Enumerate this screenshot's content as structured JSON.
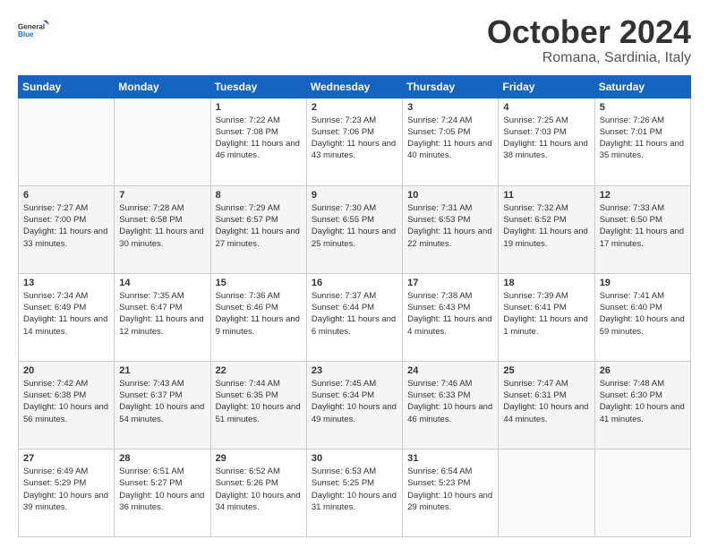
{
  "header": {
    "logo_general": "General",
    "logo_blue": "Blue",
    "month": "October 2024",
    "location": "Romana, Sardinia, Italy"
  },
  "weekdays": [
    "Sunday",
    "Monday",
    "Tuesday",
    "Wednesday",
    "Thursday",
    "Friday",
    "Saturday"
  ],
  "weeks": [
    [
      {
        "day": "",
        "sunrise": "",
        "sunset": "",
        "daylight": ""
      },
      {
        "day": "",
        "sunrise": "",
        "sunset": "",
        "daylight": ""
      },
      {
        "day": "1",
        "sunrise": "Sunrise: 7:22 AM",
        "sunset": "Sunset: 7:08 PM",
        "daylight": "Daylight: 11 hours and 46 minutes."
      },
      {
        "day": "2",
        "sunrise": "Sunrise: 7:23 AM",
        "sunset": "Sunset: 7:06 PM",
        "daylight": "Daylight: 11 hours and 43 minutes."
      },
      {
        "day": "3",
        "sunrise": "Sunrise: 7:24 AM",
        "sunset": "Sunset: 7:05 PM",
        "daylight": "Daylight: 11 hours and 40 minutes."
      },
      {
        "day": "4",
        "sunrise": "Sunrise: 7:25 AM",
        "sunset": "Sunset: 7:03 PM",
        "daylight": "Daylight: 11 hours and 38 minutes."
      },
      {
        "day": "5",
        "sunrise": "Sunrise: 7:26 AM",
        "sunset": "Sunset: 7:01 PM",
        "daylight": "Daylight: 11 hours and 35 minutes."
      }
    ],
    [
      {
        "day": "6",
        "sunrise": "Sunrise: 7:27 AM",
        "sunset": "Sunset: 7:00 PM",
        "daylight": "Daylight: 11 hours and 33 minutes."
      },
      {
        "day": "7",
        "sunrise": "Sunrise: 7:28 AM",
        "sunset": "Sunset: 6:58 PM",
        "daylight": "Daylight: 11 hours and 30 minutes."
      },
      {
        "day": "8",
        "sunrise": "Sunrise: 7:29 AM",
        "sunset": "Sunset: 6:57 PM",
        "daylight": "Daylight: 11 hours and 27 minutes."
      },
      {
        "day": "9",
        "sunrise": "Sunrise: 7:30 AM",
        "sunset": "Sunset: 6:55 PM",
        "daylight": "Daylight: 11 hours and 25 minutes."
      },
      {
        "day": "10",
        "sunrise": "Sunrise: 7:31 AM",
        "sunset": "Sunset: 6:53 PM",
        "daylight": "Daylight: 11 hours and 22 minutes."
      },
      {
        "day": "11",
        "sunrise": "Sunrise: 7:32 AM",
        "sunset": "Sunset: 6:52 PM",
        "daylight": "Daylight: 11 hours and 19 minutes."
      },
      {
        "day": "12",
        "sunrise": "Sunrise: 7:33 AM",
        "sunset": "Sunset: 6:50 PM",
        "daylight": "Daylight: 11 hours and 17 minutes."
      }
    ],
    [
      {
        "day": "13",
        "sunrise": "Sunrise: 7:34 AM",
        "sunset": "Sunset: 6:49 PM",
        "daylight": "Daylight: 11 hours and 14 minutes."
      },
      {
        "day": "14",
        "sunrise": "Sunrise: 7:35 AM",
        "sunset": "Sunset: 6:47 PM",
        "daylight": "Daylight: 11 hours and 12 minutes."
      },
      {
        "day": "15",
        "sunrise": "Sunrise: 7:36 AM",
        "sunset": "Sunset: 6:46 PM",
        "daylight": "Daylight: 11 hours and 9 minutes."
      },
      {
        "day": "16",
        "sunrise": "Sunrise: 7:37 AM",
        "sunset": "Sunset: 6:44 PM",
        "daylight": "Daylight: 11 hours and 6 minutes."
      },
      {
        "day": "17",
        "sunrise": "Sunrise: 7:38 AM",
        "sunset": "Sunset: 6:43 PM",
        "daylight": "Daylight: 11 hours and 4 minutes."
      },
      {
        "day": "18",
        "sunrise": "Sunrise: 7:39 AM",
        "sunset": "Sunset: 6:41 PM",
        "daylight": "Daylight: 11 hours and 1 minute."
      },
      {
        "day": "19",
        "sunrise": "Sunrise: 7:41 AM",
        "sunset": "Sunset: 6:40 PM",
        "daylight": "Daylight: 10 hours and 59 minutes."
      }
    ],
    [
      {
        "day": "20",
        "sunrise": "Sunrise: 7:42 AM",
        "sunset": "Sunset: 6:38 PM",
        "daylight": "Daylight: 10 hours and 56 minutes."
      },
      {
        "day": "21",
        "sunrise": "Sunrise: 7:43 AM",
        "sunset": "Sunset: 6:37 PM",
        "daylight": "Daylight: 10 hours and 54 minutes."
      },
      {
        "day": "22",
        "sunrise": "Sunrise: 7:44 AM",
        "sunset": "Sunset: 6:35 PM",
        "daylight": "Daylight: 10 hours and 51 minutes."
      },
      {
        "day": "23",
        "sunrise": "Sunrise: 7:45 AM",
        "sunset": "Sunset: 6:34 PM",
        "daylight": "Daylight: 10 hours and 49 minutes."
      },
      {
        "day": "24",
        "sunrise": "Sunrise: 7:46 AM",
        "sunset": "Sunset: 6:33 PM",
        "daylight": "Daylight: 10 hours and 46 minutes."
      },
      {
        "day": "25",
        "sunrise": "Sunrise: 7:47 AM",
        "sunset": "Sunset: 6:31 PM",
        "daylight": "Daylight: 10 hours and 44 minutes."
      },
      {
        "day": "26",
        "sunrise": "Sunrise: 7:48 AM",
        "sunset": "Sunset: 6:30 PM",
        "daylight": "Daylight: 10 hours and 41 minutes."
      }
    ],
    [
      {
        "day": "27",
        "sunrise": "Sunrise: 6:49 AM",
        "sunset": "Sunset: 5:29 PM",
        "daylight": "Daylight: 10 hours and 39 minutes."
      },
      {
        "day": "28",
        "sunrise": "Sunrise: 6:51 AM",
        "sunset": "Sunset: 5:27 PM",
        "daylight": "Daylight: 10 hours and 36 minutes."
      },
      {
        "day": "29",
        "sunrise": "Sunrise: 6:52 AM",
        "sunset": "Sunset: 5:26 PM",
        "daylight": "Daylight: 10 hours and 34 minutes."
      },
      {
        "day": "30",
        "sunrise": "Sunrise: 6:53 AM",
        "sunset": "Sunset: 5:25 PM",
        "daylight": "Daylight: 10 hours and 31 minutes."
      },
      {
        "day": "31",
        "sunrise": "Sunrise: 6:54 AM",
        "sunset": "Sunset: 5:23 PM",
        "daylight": "Daylight: 10 hours and 29 minutes."
      },
      {
        "day": "",
        "sunrise": "",
        "sunset": "",
        "daylight": ""
      },
      {
        "day": "",
        "sunrise": "",
        "sunset": "",
        "daylight": ""
      }
    ]
  ]
}
